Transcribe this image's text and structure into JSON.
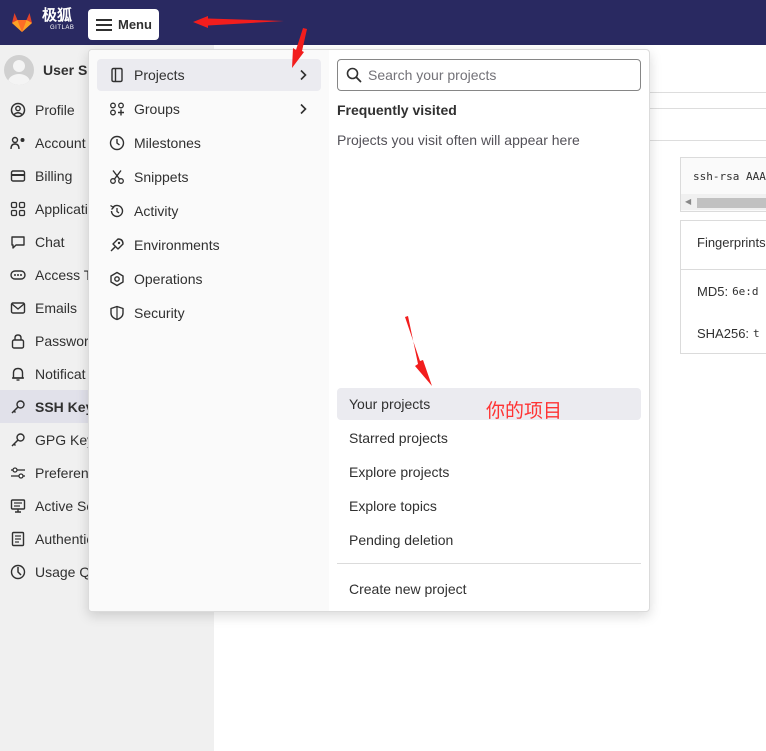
{
  "brand": {
    "name": "极狐",
    "sub": "GITLAB"
  },
  "menu_button": {
    "label": "Menu"
  },
  "sidebar": {
    "user_name": "User Se",
    "items": [
      {
        "label": "Profile",
        "icon": "profile-icon",
        "active": false
      },
      {
        "label": "Account",
        "icon": "account-icon",
        "active": false
      },
      {
        "label": "Billing",
        "icon": "billing-icon",
        "active": false
      },
      {
        "label": "Applicati",
        "icon": "applications-icon",
        "active": false
      },
      {
        "label": "Chat",
        "icon": "chat-icon",
        "active": false
      },
      {
        "label": "Access To",
        "icon": "access-token-icon",
        "active": false
      },
      {
        "label": "Emails",
        "icon": "email-icon",
        "active": false
      },
      {
        "label": "Passwor",
        "icon": "lock-icon",
        "active": false
      },
      {
        "label": "Notificat",
        "icon": "bell-icon",
        "active": false
      },
      {
        "label": "SSH Key",
        "icon": "key-icon",
        "active": true
      },
      {
        "label": "GPG Key",
        "icon": "key-icon",
        "active": false
      },
      {
        "label": "Preferen",
        "icon": "preferences-icon",
        "active": false
      },
      {
        "label": "Active Se",
        "icon": "monitor-icon",
        "active": false
      },
      {
        "label": "Authentic",
        "icon": "log-icon",
        "active": false
      },
      {
        "label": "Usage Q",
        "icon": "quota-icon",
        "active": false
      }
    ]
  },
  "main": {
    "key_text": "ssh-rsa AAA",
    "fingerprints_title": "Fingerprints",
    "md5_label": "MD5:",
    "md5_value": "6e:d",
    "sha_label": "SHA256:",
    "sha_value": "t"
  },
  "dropdown": {
    "nav": [
      {
        "label": "Projects",
        "icon": "project-icon",
        "chevron": true,
        "active": true
      },
      {
        "label": "Groups",
        "icon": "group-icon",
        "chevron": true,
        "active": false
      },
      {
        "label": "Milestones",
        "icon": "clock-icon",
        "chevron": false,
        "active": false
      },
      {
        "label": "Snippets",
        "icon": "scissors-icon",
        "chevron": false,
        "active": false
      },
      {
        "label": "Activity",
        "icon": "history-icon",
        "chevron": false,
        "active": false
      },
      {
        "label": "Environments",
        "icon": "rocket-icon",
        "chevron": false,
        "active": false
      },
      {
        "label": "Operations",
        "icon": "cloud-gear-icon",
        "chevron": false,
        "active": false
      },
      {
        "label": "Security",
        "icon": "shield-icon",
        "chevron": false,
        "active": false
      }
    ],
    "search_placeholder": "Search your projects",
    "frequently_visited_title": "Frequently visited",
    "frequently_visited_empty": "Projects you visit often will appear here",
    "links": [
      {
        "label": "Your projects",
        "active": true
      },
      {
        "label": "Starred projects",
        "active": false
      },
      {
        "label": "Explore projects",
        "active": false
      },
      {
        "label": "Explore topics",
        "active": false
      },
      {
        "label": "Pending deletion",
        "active": false
      }
    ],
    "create_label": "Create new project"
  },
  "annotation": {
    "text": "你的项目",
    "color": "#ff3333"
  },
  "colors": {
    "topbar": "#292961",
    "sidebar_bg": "#f0f0f0",
    "active_bg": "#ebebf0"
  }
}
